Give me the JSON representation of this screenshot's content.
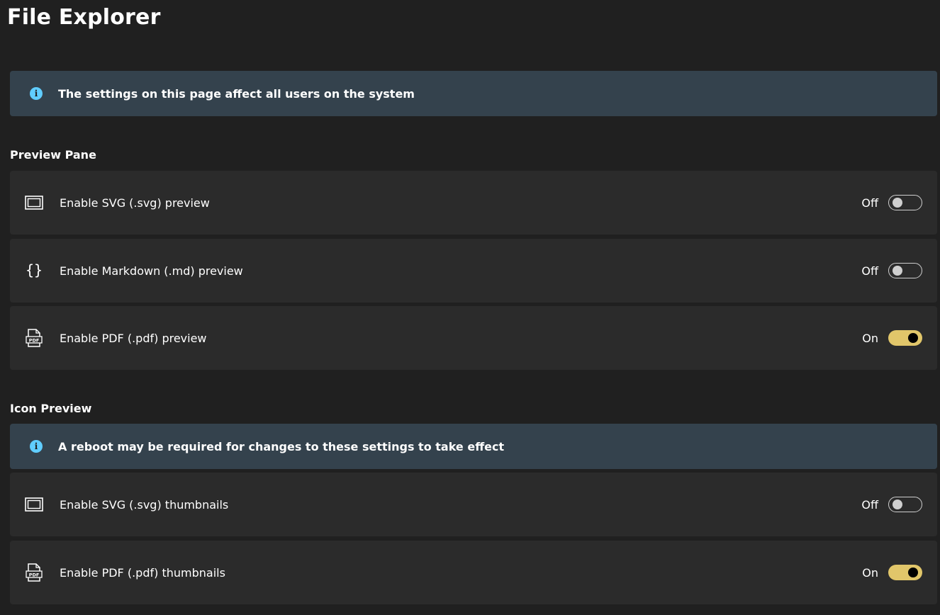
{
  "page": {
    "title": "File Explorer"
  },
  "banner_all_users": {
    "icon": "info-icon",
    "text": "The settings on this page affect all users on the system",
    "color": "#34424d"
  },
  "preview_pane": {
    "title": "Preview Pane",
    "items": [
      {
        "icon": "svg-file-icon",
        "label": "Enable SVG (.svg) preview",
        "state": "Off",
        "on": false
      },
      {
        "icon": "markdown-braces-icon",
        "label": "Enable Markdown (.md) preview",
        "state": "Off",
        "on": false
      },
      {
        "icon": "pdf-file-icon",
        "label": "Enable PDF (.pdf) preview",
        "state": "On",
        "on": true
      }
    ]
  },
  "icon_preview": {
    "title": "Icon Preview",
    "banner": {
      "icon": "info-icon",
      "text": "A reboot may be required for changes to these settings to take effect"
    },
    "items": [
      {
        "icon": "svg-file-icon",
        "label": "Enable SVG (.svg) thumbnails",
        "state": "Off",
        "on": false
      },
      {
        "icon": "pdf-file-icon",
        "label": "Enable PDF (.pdf) thumbnails",
        "state": "On",
        "on": true
      }
    ]
  },
  "colors": {
    "toggle_on": "#e1c66a",
    "accent_info": "#60cdff",
    "background": "#202020",
    "card": "#2b2b2b"
  }
}
